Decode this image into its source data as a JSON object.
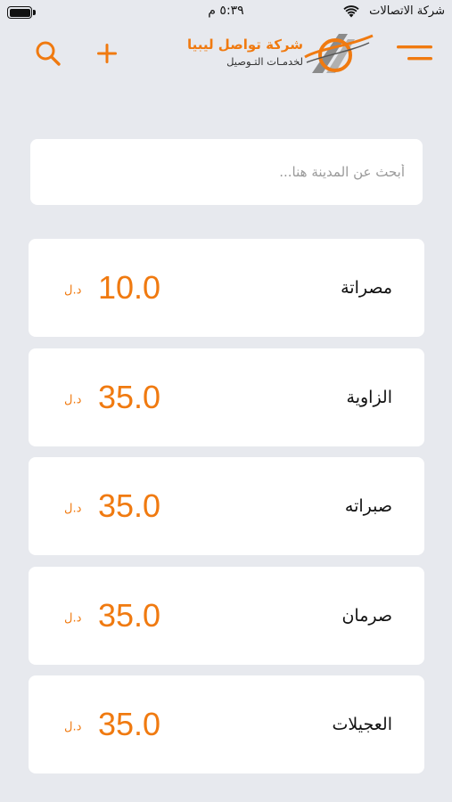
{
  "status_bar": {
    "carrier": "شركة الاتصالات",
    "time": "٥:٣٩ م"
  },
  "header": {
    "logo_title": "شركة تواصل ليبيا",
    "logo_subtitle": "لخدمـات التـوصيل",
    "icons": {
      "menu": "menu-icon",
      "add": "plus-icon",
      "search": "search-icon"
    }
  },
  "search": {
    "placeholder": "أبحث عن المدينة هنا...",
    "value": ""
  },
  "colors": {
    "accent": "#f07a10",
    "background": "#e7e9ee",
    "card": "#ffffff"
  },
  "cities": [
    {
      "name": "مصراتة",
      "price": "10.0",
      "currency": "د.ل"
    },
    {
      "name": "الزاوية",
      "price": "35.0",
      "currency": "د.ل"
    },
    {
      "name": "صبراته",
      "price": "35.0",
      "currency": "د.ل"
    },
    {
      "name": "صرمان",
      "price": "35.0",
      "currency": "د.ل"
    },
    {
      "name": "العجيلات",
      "price": "35.0",
      "currency": "د.ل"
    }
  ]
}
